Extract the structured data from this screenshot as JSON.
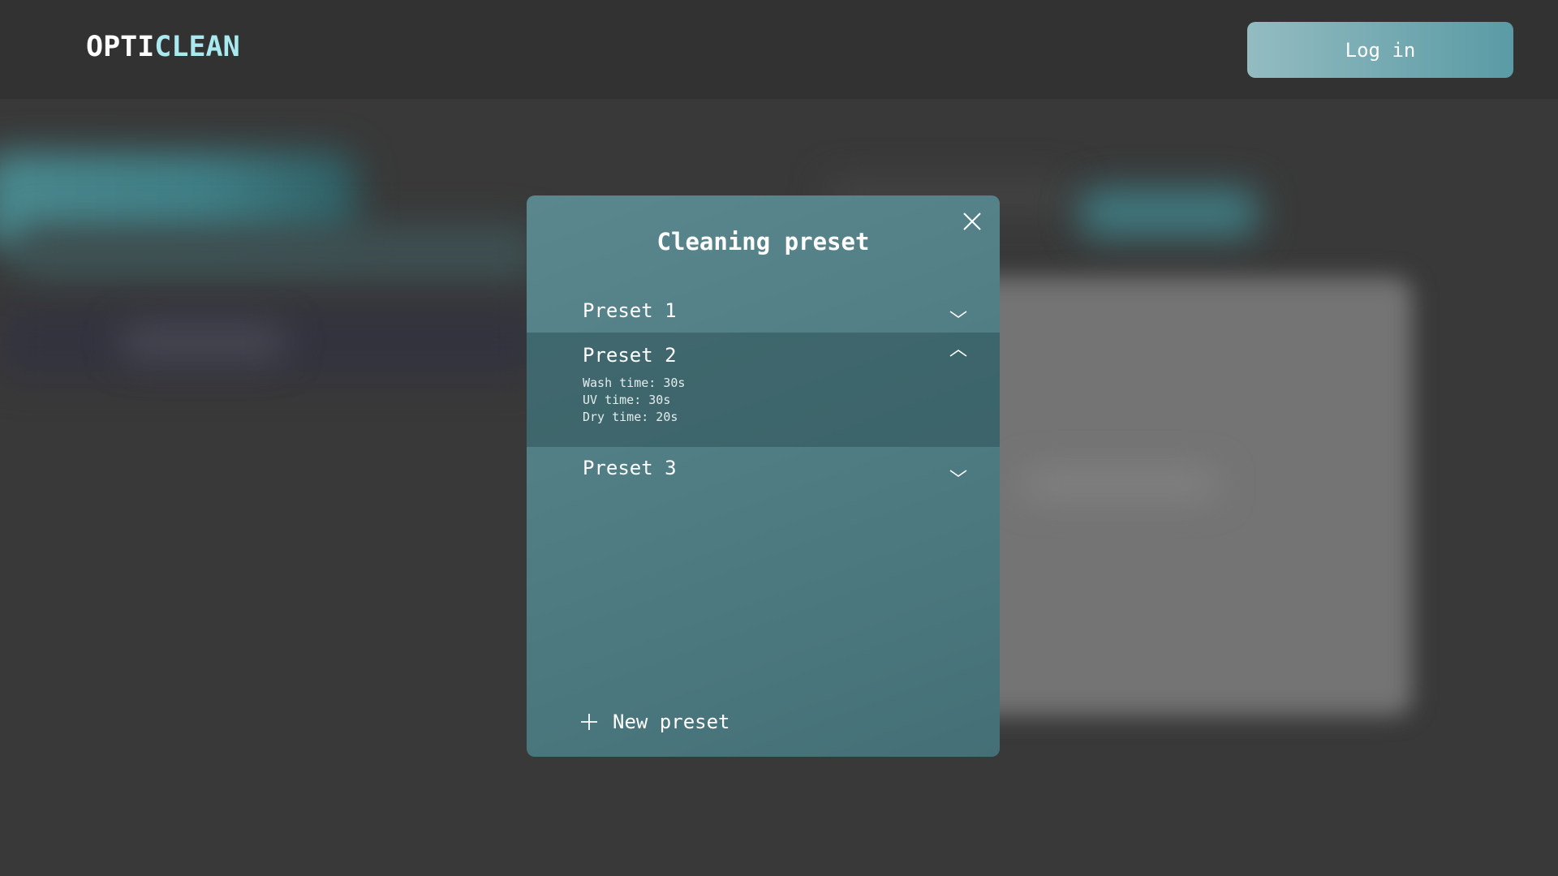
{
  "header": {
    "logo_part1": "OPTI",
    "logo_part2": "CLEAN",
    "login_label": "Log in"
  },
  "modal": {
    "title": "Cleaning preset",
    "close_icon": "close-icon",
    "presets": [
      {
        "name": "Preset 1",
        "expanded": false
      },
      {
        "name": "Preset 2",
        "expanded": true,
        "details": [
          "Wash time: 30s",
          "UV time: 30s",
          "Dry time: 20s"
        ]
      },
      {
        "name": "Preset 3",
        "expanded": false
      }
    ],
    "new_preset_label": "New preset"
  },
  "colors": {
    "header_bg": "#323232",
    "page_bg": "#393939",
    "logo_accent": "#a8eaf0",
    "modal_bg": "#5a878d",
    "login_button": "#74a9b1"
  }
}
